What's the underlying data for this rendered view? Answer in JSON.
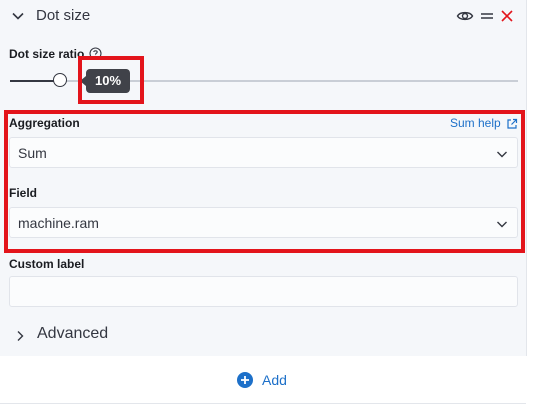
{
  "panel": {
    "title": "Dot size",
    "icons": {
      "toggle": "chevron-down-icon",
      "visibility": "eye-icon",
      "drag": "drag-handle-icon",
      "remove": "close-icon"
    },
    "colors": {
      "remove": "#e3141b",
      "link": "#1d70c9",
      "tooltip": "#404249",
      "highlight": "#e3141b"
    }
  },
  "dot_size_ratio": {
    "label": "Dot size ratio",
    "value_label": "10%",
    "value": 10
  },
  "aggregation": {
    "label": "Aggregation",
    "help_link": "Sum help",
    "selected": "Sum"
  },
  "field": {
    "label": "Field",
    "selected": "machine.ram"
  },
  "custom_label": {
    "label": "Custom label",
    "value": ""
  },
  "advanced": {
    "label": "Advanced"
  },
  "add": {
    "label": "Add"
  }
}
